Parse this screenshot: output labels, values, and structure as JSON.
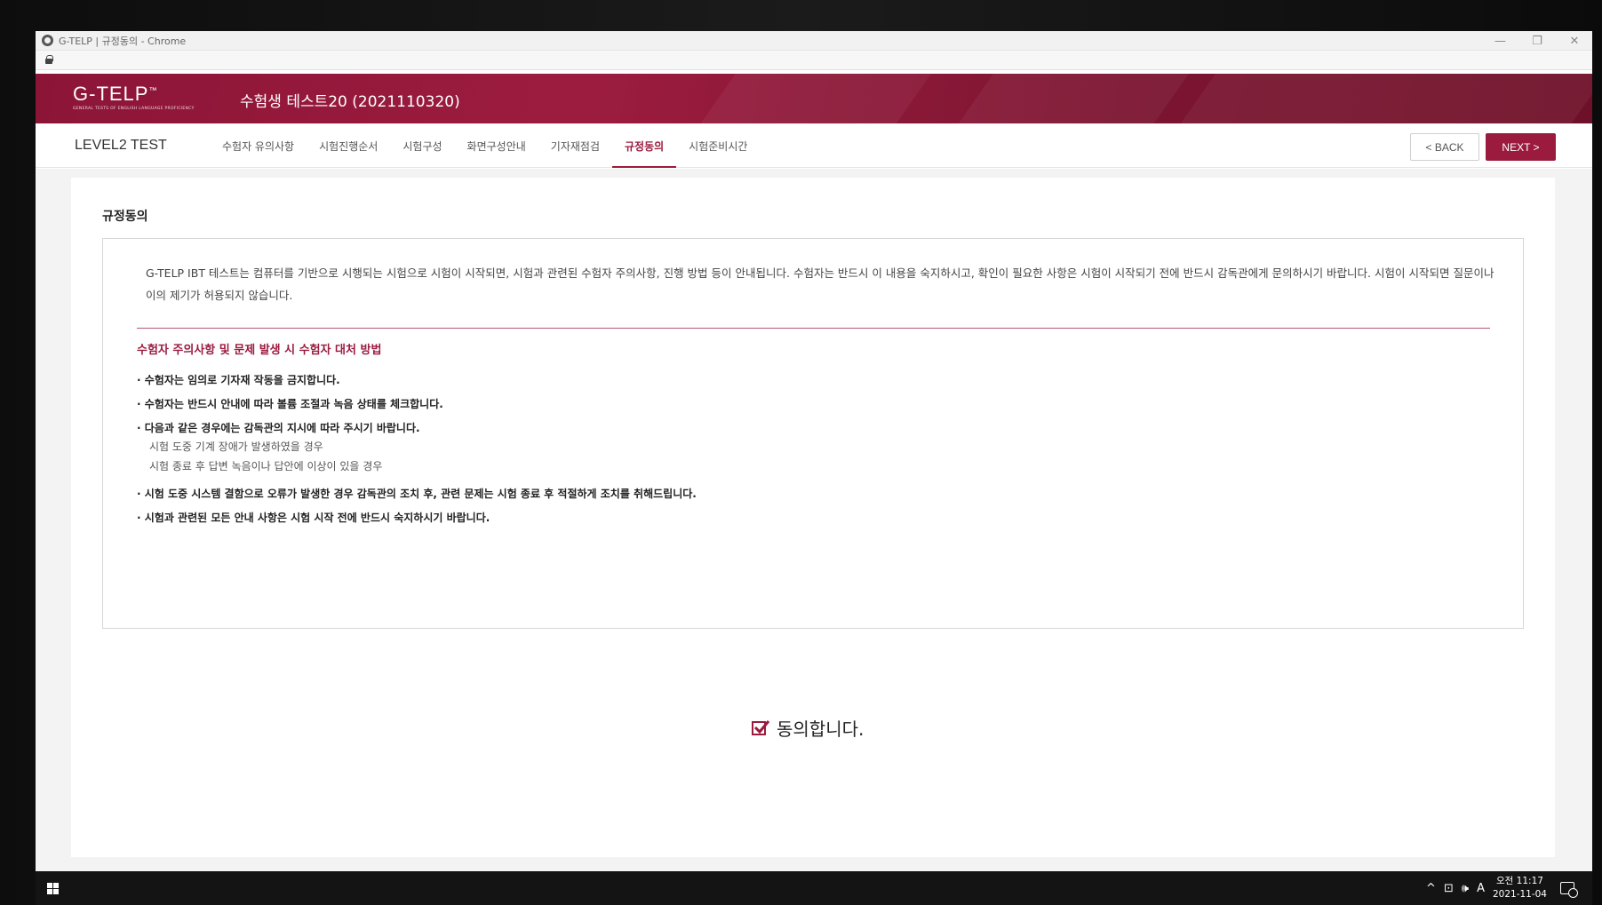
{
  "window": {
    "title": "G-TELP | 규정동의 - Chrome",
    "minimize": "—",
    "restore": "❐",
    "close": "✕"
  },
  "header": {
    "logo_main": "G-TELP",
    "logo_tm": "™",
    "logo_sub": "GENERAL TESTS OF ENGLISH LANGUAGE PROFICIENCY",
    "candidate": "수험생 테스트20 (2021110320)"
  },
  "nav": {
    "level": "LEVEL2 TEST",
    "tabs": [
      {
        "label": "수험자 유의사항"
      },
      {
        "label": "시험진행순서"
      },
      {
        "label": "시험구성"
      },
      {
        "label": "화면구성안내"
      },
      {
        "label": "기자재점검"
      },
      {
        "label": "규정동의"
      },
      {
        "label": "시험준비시간"
      }
    ],
    "active_tab": "규정동의",
    "back_label": "< BACK",
    "next_label": "NEXT >"
  },
  "content": {
    "section_title": "규정동의",
    "intro": "G-TELP IBT 테스트는 컴퓨터를 기반으로 시행되는 시험으로 시험이 시작되면, 시험과 관련된 수험자 주의사항, 진행 방법 등이 안내됩니다. 수험자는 반드시 이 내용을 숙지하시고, 확인이 필요한 사항은 시험이 시작되기 전에 반드시 감독관에게 문의하시기 바랍니다. 시험이 시작되면 질문이나 이의 제기가 허용되지 않습니다.",
    "notice_title": "수험자 주의사항 및 문제 발생 시 수험자 대처 방법",
    "rules": [
      "· 수험자는 임의로 기자재 작동을 금지합니다.",
      "· 수험자는 반드시 안내에 따라 볼륨 조절과 녹음 상태를 체크합니다.",
      "· 다음과 같은 경우에는 감독관의 지시에 따라 주시기 바랍니다."
    ],
    "subrules": [
      "시험 도중 기계 장애가 발생하였을 경우",
      "시험 종료 후 답변 녹음이나 답안에 이상이 있을 경우"
    ],
    "rules_after": [
      "· 시험 도중 시스템 결함으로 오류가 발생한 경우 감독관의 조치 후, 관련 문제는 시험 종료 후 적절하게 조치를 취해드립니다.",
      "· 시험과 관련된 모든 안내 사항은 시험 시작 전에 반드시 숙지하시기 바랍니다."
    ],
    "agree_label": "동의합니다.",
    "agree_checked": true
  },
  "taskbar": {
    "tray_icons": [
      "^",
      "⊡",
      "🕪",
      "A"
    ],
    "time": "오전 11:17",
    "date": "2021-11-04"
  },
  "colors": {
    "brand": "#9b1b3e",
    "header_bg": "#8c1537"
  }
}
